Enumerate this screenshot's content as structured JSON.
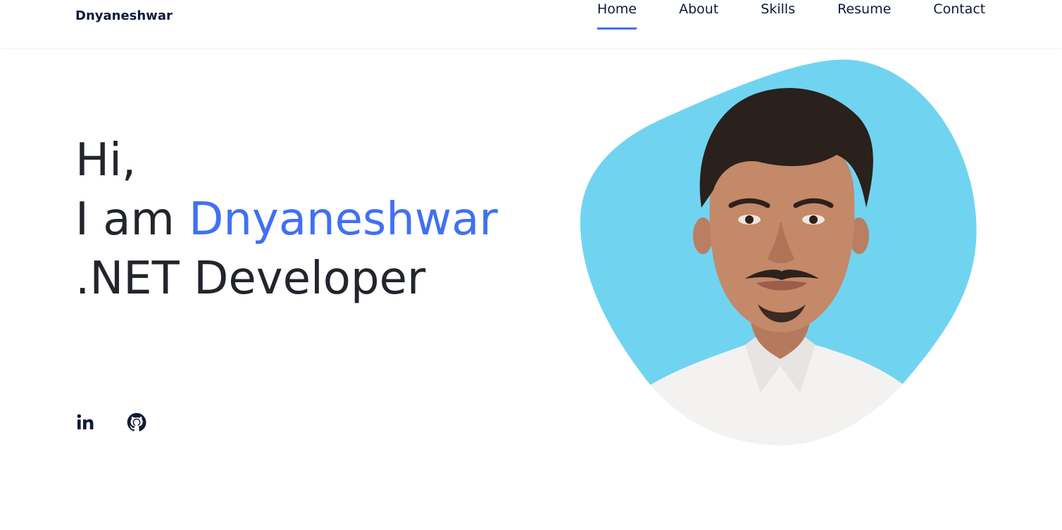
{
  "header": {
    "brand": "Dnyaneshwar",
    "nav": [
      {
        "label": "Home",
        "active": true
      },
      {
        "label": "About",
        "active": false
      },
      {
        "label": "Skills",
        "active": false
      },
      {
        "label": "Resume",
        "active": false
      },
      {
        "label": "Contact",
        "active": false
      }
    ]
  },
  "hero": {
    "line1": "Hi,",
    "line2_prefix": "I am ",
    "name": "Dnyaneshwar",
    "line3": ".NET Developer"
  },
  "social": [
    {
      "icon": "linkedin-icon"
    },
    {
      "icon": "github-icon"
    }
  ],
  "colors": {
    "accent": "#4070f4",
    "blob": "#70d4f0",
    "text": "#22252b",
    "nav_text": "#0f1a3a"
  }
}
